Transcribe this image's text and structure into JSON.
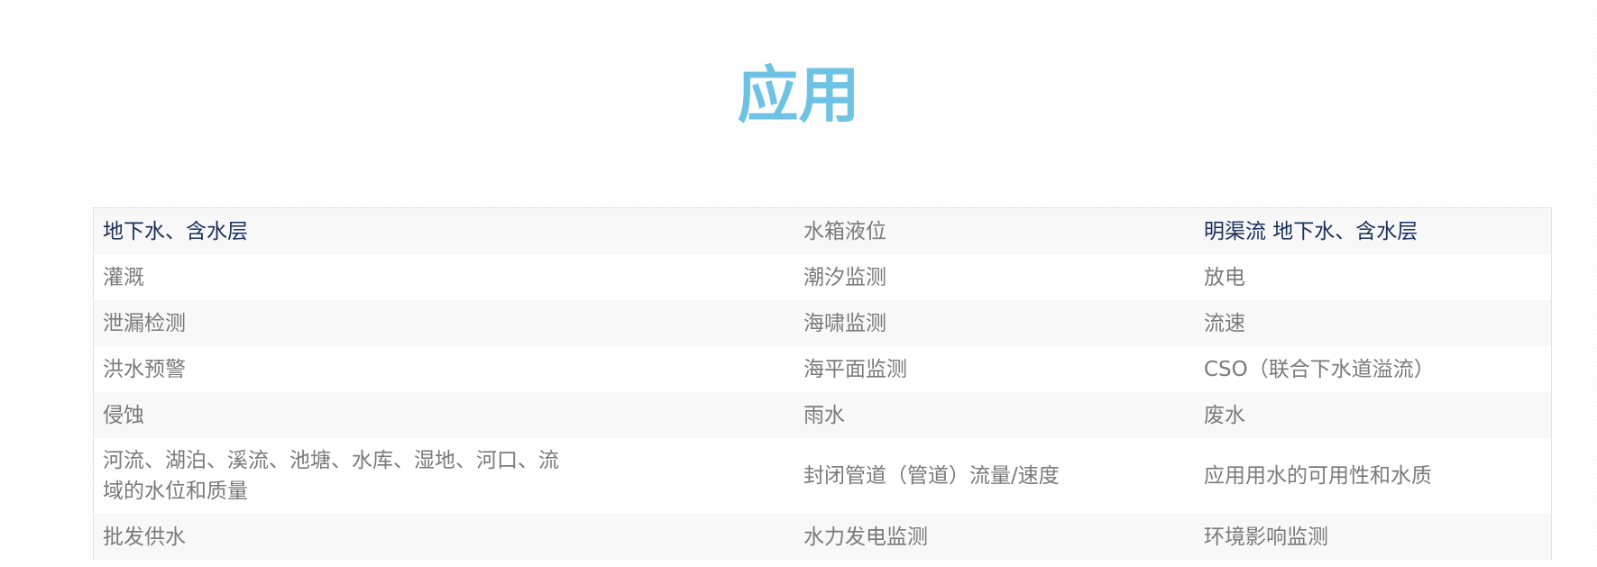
{
  "title": "应用",
  "colors": {
    "title": "#6ec3e4",
    "highlight_text": "#1a2f5a",
    "body_text": "#7a7a7a"
  },
  "table": {
    "rows": [
      [
        "地下水、含水层",
        "水箱液位",
        "明渠流 地下水、含水层"
      ],
      [
        "灌溉",
        "潮汐监测",
        "放电"
      ],
      [
        "泄漏检测",
        "海啸监测",
        "流速"
      ],
      [
        "洪水预警",
        "海平面监测",
        "CSO（联合下水道溢流）"
      ],
      [
        "侵蚀",
        "雨水",
        "废水"
      ],
      [
        "河流、湖泊、溪流、池塘、水库、湿地、河口、流域的水位和质量",
        "封闭管道（管道）流量/速度",
        "应用用水的可用性和水质"
      ],
      [
        "批发供水",
        "水力发电监测",
        "环境影响监测"
      ]
    ]
  }
}
